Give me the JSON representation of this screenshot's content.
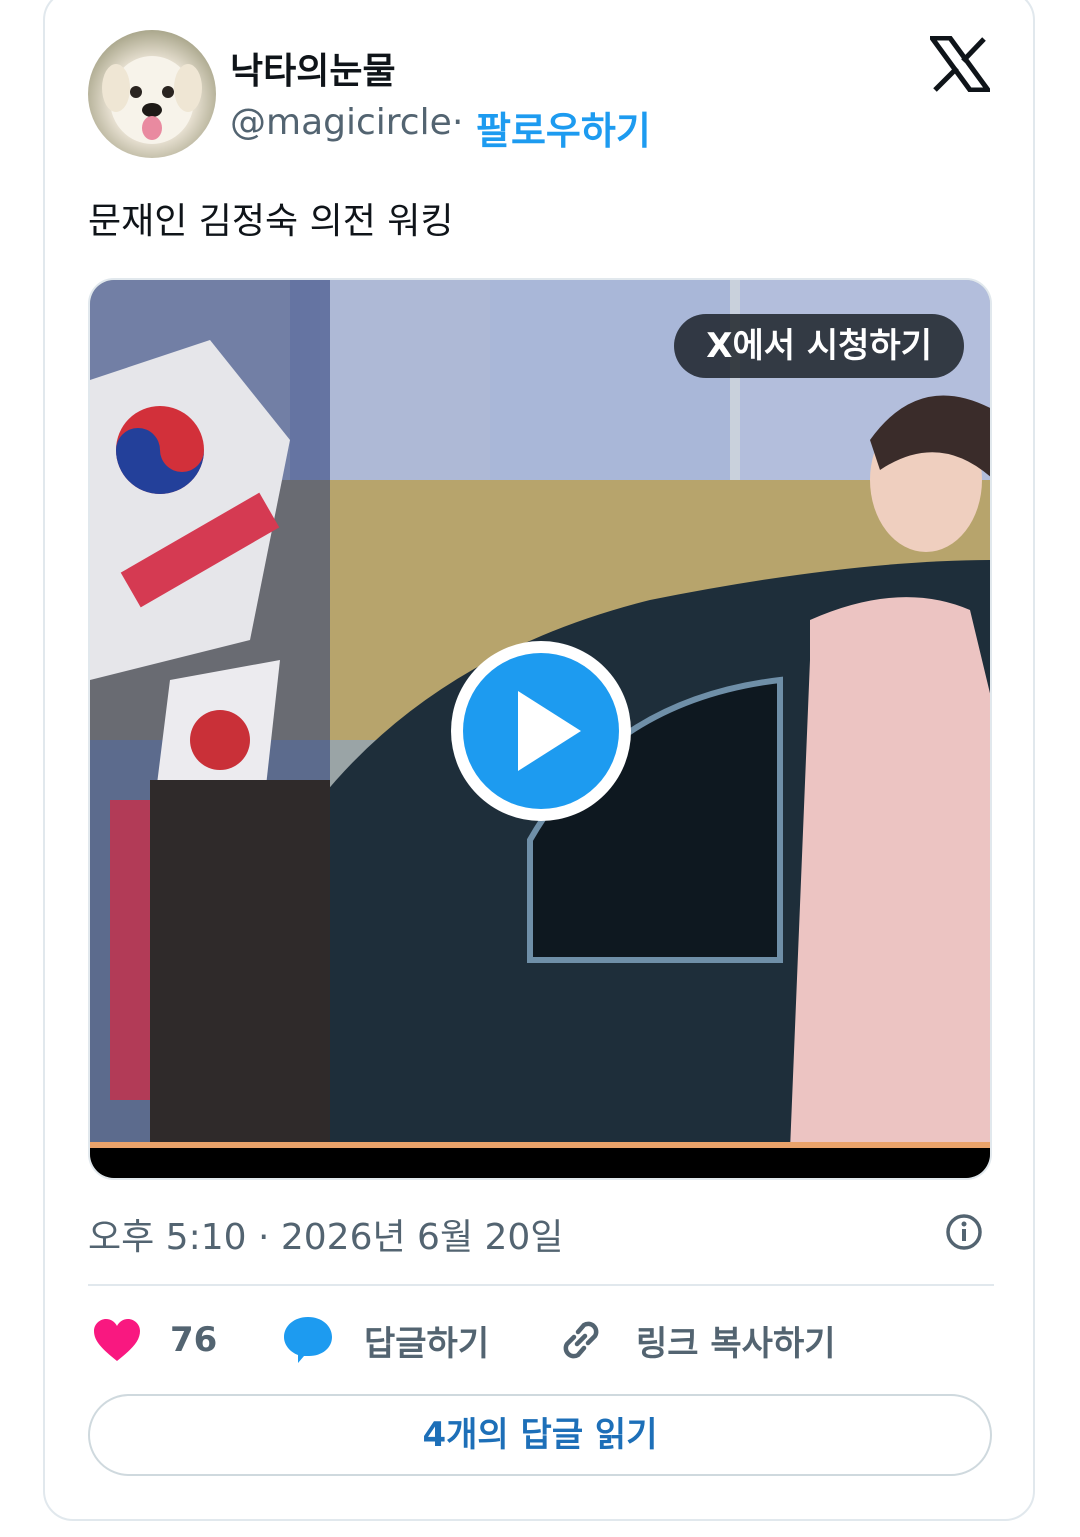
{
  "author": {
    "display_name": "낙타의눈물",
    "handle": "@magicircle",
    "separator": "·",
    "follow_label": "팔로우하기"
  },
  "tweet": {
    "text": "문재인 김정숙 의전 워킹",
    "media": {
      "watch_label": "X에서 시청하기"
    },
    "timestamp": "오후 5:10 · 2026년 6월 20일"
  },
  "actions": {
    "like_count": "76",
    "reply_label": "답글하기",
    "copy_link_label": "링크 복사하기"
  },
  "read_replies_label": "4개의 답글 읽기",
  "colors": {
    "accent": "#1d9bf0",
    "like": "#f91880",
    "muted": "#536471"
  },
  "icons": [
    "x-logo-icon",
    "play-icon",
    "info-icon",
    "heart-icon",
    "reply-bubble-icon",
    "link-icon"
  ]
}
